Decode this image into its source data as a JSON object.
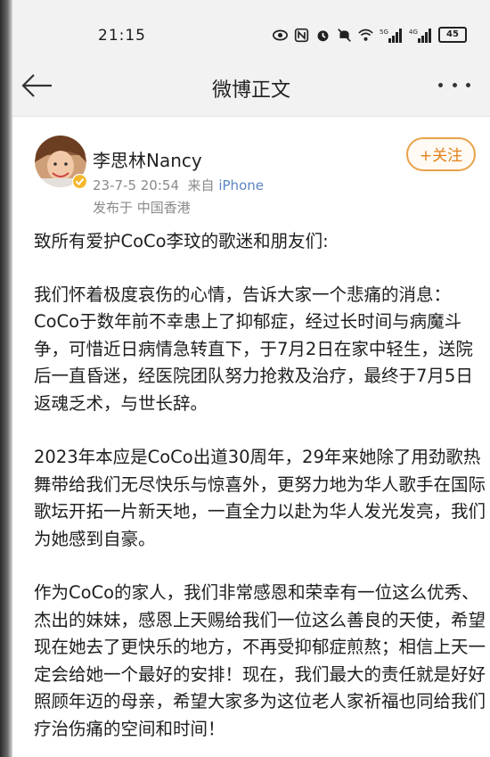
{
  "status_bar": {
    "time": "21:15",
    "battery": "45",
    "icons": [
      "eye-icon",
      "nfc-icon",
      "alarm-icon",
      "mute-icon",
      "wifi-icon",
      "signal-5g-icon",
      "signal-4g-icon",
      "battery-icon"
    ],
    "signal_5g_label": "5G",
    "signal_4g_label": "4G"
  },
  "nav": {
    "title": "微博正文",
    "back_icon": "arrow-left-icon",
    "more_icon": "more-dots-icon"
  },
  "post": {
    "author": "李思林Nancy",
    "date": "23-7-5 20:54",
    "source_prefix": "来自",
    "source": "iPhone",
    "location": "发布于 中国香港",
    "follow_label": "+关注",
    "paragraphs": [
      "致所有爱护CoCo李玟的歌迷和朋友们:",
      "我们怀着极度哀伤的心情，告诉大家一个悲痛的消息：CoCo于数年前不幸患上了抑郁症，经过长时间与病魔斗争，可惜近日病情急转直下，于7月2日在家中轻生，送院后一直昏迷，经医院团队努力抢救及治疗，最终于7月5日返魂乏术，与世长辞。",
      "2023年本应是CoCo出道30周年，29年来她除了用劲歌热舞带给我们无尽快乐与惊喜外，更努力地为华人歌手在国际歌坛开拓一片新天地，一直全力以赴为华人发光发亮，我们为她感到自豪。",
      "作为CoCo的家人，我们非常感恩和荣幸有一位这么优秀、杰出的妹妹，感恩上天赐给我们一位这么善良的天使，希望现在她去了更快乐的地方，不再受抑郁症煎熬；相信上天一定会给她一个最好的安排！现在，我们最大的责任就是好好照顾年迈的母亲，希望大家多为这位老人家祈福也同给我们疗治伤痛的空间和时间！"
    ]
  },
  "colors": {
    "follow_accent": "#e0801a",
    "source_link": "#5b85c4",
    "meta_gray": "#8a8a8a",
    "bar_bg": "#f2f2f2"
  }
}
